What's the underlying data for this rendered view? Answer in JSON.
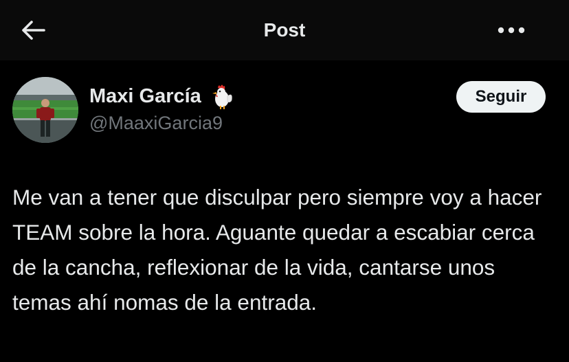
{
  "header": {
    "title": "Post",
    "back_icon": "arrow-left-icon",
    "more_icon": "more-horizontal-icon"
  },
  "post": {
    "author": {
      "name": "Maxi García",
      "emoji_icon": "rooster-emoji-icon",
      "handle": "@MaaxiGarcia9"
    },
    "follow_label": "Seguir",
    "text": "Me van a tener que disculpar pero siempre voy a hacer TEAM sobre la hora. Aguante quedar a escabiar cerca de la cancha, reflexionar de la vida, cantarse unos temas ahí nomas de la entrada."
  },
  "colors": {
    "background": "#000000",
    "header_background": "#0a0a0a",
    "primary_text": "#e7e9ea",
    "secondary_text": "#71767b",
    "button_background": "#eff3f4",
    "button_text": "#0f1419"
  }
}
